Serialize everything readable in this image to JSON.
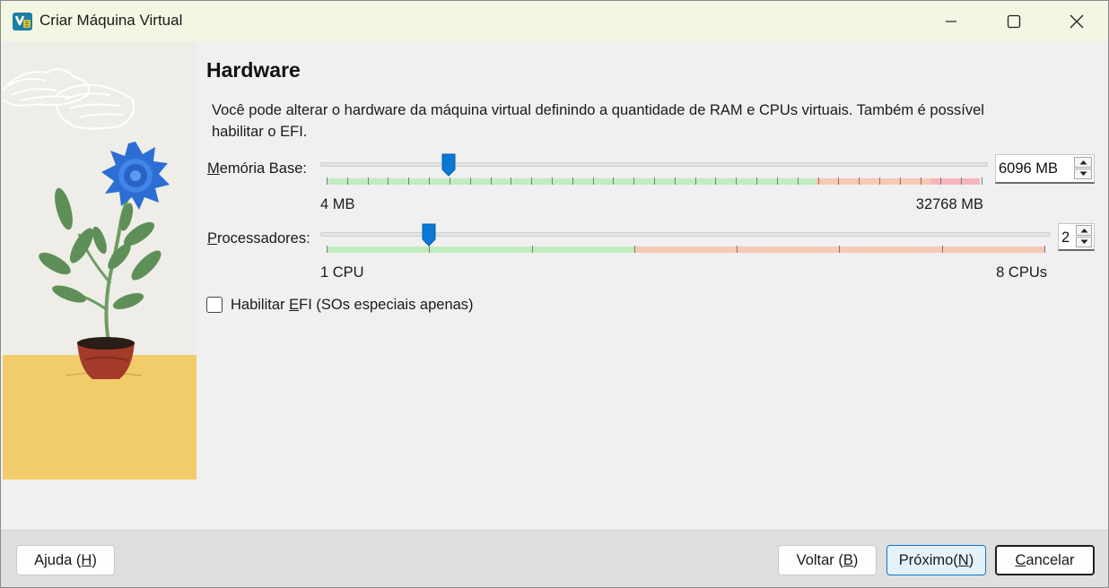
{
  "window": {
    "title": "Criar Máquina Virtual"
  },
  "page": {
    "heading": "Hardware",
    "description": "Você pode alterar o hardware da máquina virtual definindo a quantidade de RAM e CPUs virtuais. Também é possível habilitar o EFI."
  },
  "memory": {
    "label_accel": "M",
    "label_rest": "emória Base:",
    "value": "6096 MB",
    "min_label": "4 MB",
    "max_label": "32768 MB",
    "min": 4,
    "max": 32768,
    "current": 6096
  },
  "processors": {
    "label_accel": "P",
    "label_rest": "rocessadores:",
    "value": "2",
    "min_label": "1 CPU",
    "max_label": "8 CPUs",
    "min": 1,
    "max": 8,
    "current": 2
  },
  "efi": {
    "label_pre": "Habilitar ",
    "label_accel": "E",
    "label_rest": "FI (SOs especiais apenas)",
    "checked": false
  },
  "buttons": {
    "help_pre": "Ajuda (",
    "help_accel": "H",
    "help_post": ")",
    "back_pre": "Voltar (",
    "back_accel": "B",
    "back_post": ")",
    "next_pre": "Próximo(",
    "next_accel": "N",
    "next_post": ")",
    "cancel_accel": "C",
    "cancel_rest": "ancelar"
  },
  "colors": {
    "accent": "#0a78d4",
    "slider_recommended": "#c0ecc0",
    "slider_warning": "#f6c9b4",
    "slider_danger": "#f6b5bd",
    "titlebar": "#f3f6e3"
  },
  "icons": {
    "app": "virtualbox-icon",
    "minimize": "minimize-icon",
    "maximize": "maximize-icon",
    "close": "close-icon"
  }
}
